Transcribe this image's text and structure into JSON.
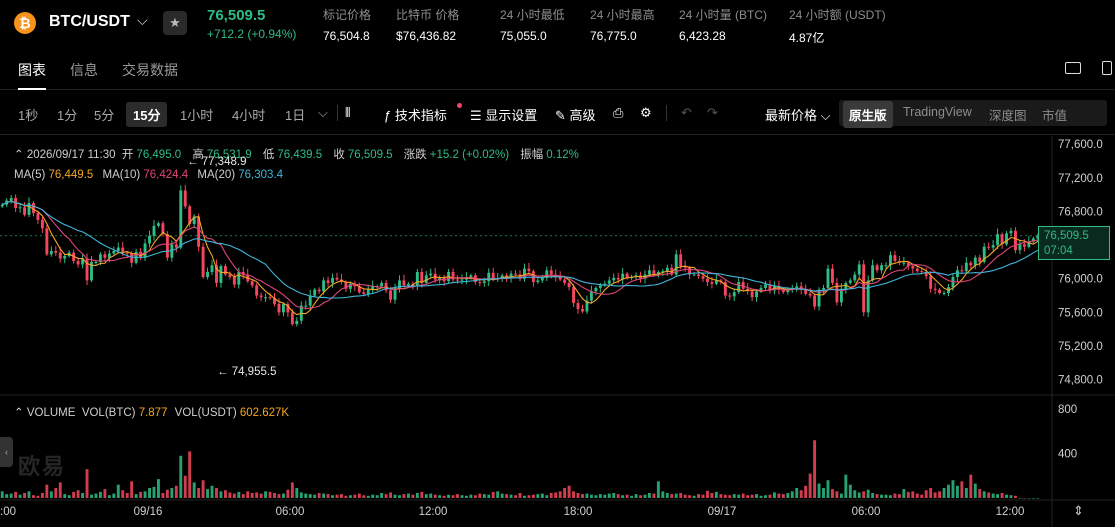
{
  "header": {
    "coin_symbol_glyph": "₿",
    "pair": "BTC/USDT",
    "last_price": "76,509.5",
    "change": "+712.2 (+0.94%)",
    "stats": [
      {
        "label": "标记价格",
        "value": "76,504.8"
      },
      {
        "label": "比特币 价格",
        "value": "$76,436.82"
      },
      {
        "label": "24 小时最低",
        "value": "75,055.0"
      },
      {
        "label": "24 小时最高",
        "value": "76,775.0"
      },
      {
        "label": "24 小时量 (BTC)",
        "value": "6,423.28"
      },
      {
        "label": "24 小时额 (USDT)",
        "value": "4.87亿"
      }
    ]
  },
  "tabs": [
    "图表",
    "信息",
    "交易数据"
  ],
  "toolbar": {
    "intervals": [
      "1秒",
      "1分",
      "5分",
      "15分",
      "1小时",
      "4小时",
      "1日"
    ],
    "selected_interval": "15分",
    "indicators_label": "技术指标",
    "display_label": "显示设置",
    "advanced_label": "高级",
    "price_type": "最新价格",
    "views": [
      "原生版",
      "TradingView",
      "深度图",
      "市值"
    ],
    "selected_view": "原生版"
  },
  "legend": {
    "datetime": "2026/09/17 11:30",
    "open_label": "开",
    "open": "76,495.0",
    "high_label": "高",
    "high": "76,531.9",
    "low_label": "低",
    "low": "76,439.5",
    "close_label": "收",
    "close": "76,509.5",
    "change_label": "涨跌",
    "change": "+15.2 (+0.02%)",
    "amp_label": "振幅",
    "amp": "0.12%",
    "ma5_label": "MA(5)",
    "ma5": "76,449.5",
    "ma10_label": "MA(10)",
    "ma10": "76,424.4",
    "ma20_label": "MA(20)",
    "ma20": "76,303.4",
    "volume_label": "VOLUME",
    "vol_btc_label": "VOL(BTC)",
    "vol_btc": "7.877",
    "vol_usdt_label": "VOL(USDT)",
    "vol_usdt": "602.627K"
  },
  "annotations": {
    "high_marker": "← 77,348.9",
    "low_marker": "← 74,955.5"
  },
  "price_tag": {
    "price": "76,509.5",
    "countdown": "07:04"
  },
  "watermark": "欧易",
  "colors": {
    "up": "#2ebd85",
    "down": "#f6465d",
    "ma5": "#f5a623",
    "ma10": "#e0457b",
    "ma20": "#3fb6d9",
    "accent": "#2ebd85"
  },
  "chart_data": {
    "type": "candlestick",
    "y_axis_ticks": [
      "77,600.0",
      "77,200.0",
      "76,800.0",
      "76,400.0",
      "76,000.0",
      "75,600.0",
      "75,200.0",
      "74,800.0"
    ],
    "y_range": [
      74700,
      77650
    ],
    "volume_ticks": [
      "800",
      "400"
    ],
    "volume_range": [
      0,
      900
    ],
    "x_axis_ticks": [
      ":00",
      "09/16",
      "06:00",
      "12:00",
      "18:00",
      "09/17",
      "06:00",
      "12:00"
    ],
    "close_path": [
      76880,
      76930,
      76960,
      76840,
      76850,
      76760,
      76900,
      76780,
      76700,
      76600,
      76290,
      76330,
      76310,
      76240,
      76270,
      76310,
      76210,
      76170,
      76240,
      75980,
      76200,
      76200,
      76290,
      76250,
      76300,
      76330,
      76370,
      76310,
      76300,
      76190,
      76320,
      76250,
      76420,
      76510,
      76630,
      76660,
      76530,
      76250,
      76410,
      76370,
      77050,
      76860,
      76650,
      76740,
      76380,
      76020,
      76080,
      76160,
      75950,
      76150,
      76050,
      76020,
      75930,
      76080,
      76050,
      75970,
      75920,
      75800,
      75780,
      75780,
      75770,
      75700,
      75600,
      75700,
      75600,
      75460,
      75500,
      75680,
      75680,
      75800,
      75870,
      75850,
      75980,
      75950,
      76010,
      75990,
      75960,
      75880,
      75940,
      75910,
      75840,
      75820,
      75870,
      75910,
      75910,
      75950,
      75860,
      75750,
      75890,
      75980,
      75920,
      75940,
      75910,
      76080,
      75950,
      76040,
      76060,
      75990,
      76020,
      75970,
      76080,
      75990,
      75980,
      75990,
      76010,
      76040,
      75960,
      75950,
      75970,
      76070,
      75990,
      76000,
      76040,
      76010,
      76060,
      76050,
      76000,
      76120,
      76090,
      75960,
      75980,
      76010,
      76100,
      76050,
      76020,
      75990,
      75950,
      75900,
      75710,
      75640,
      75610,
      75740,
      75850,
      75890,
      75920,
      75940,
      75980,
      76010,
      75990,
      76060,
      76010,
      76020,
      76040,
      76000,
      76050,
      76100,
      76050,
      76080,
      76090,
      76130,
      76050,
      76290,
      76150,
      76130,
      76050,
      76050,
      76030,
      76000,
      75960,
      75940,
      75980,
      75960,
      75800,
      75790,
      75840,
      75960,
      75880,
      75850,
      75780,
      75850,
      75890,
      75930,
      75860,
      75910,
      75870,
      75840,
      75870,
      75890,
      75910,
      75870,
      75820,
      75800,
      75670,
      75870,
      75890,
      76120,
      75950,
      75720,
      75880,
      75950,
      75980,
      76050,
      76170,
      75600,
      75980,
      76160,
      76100,
      76160,
      76160,
      76280,
      76210,
      76190,
      76190,
      76150,
      76120,
      76090,
      76080,
      76030,
      75880,
      75870,
      75830,
      75830,
      75900,
      76020,
      76100,
      76090,
      76190,
      76160,
      76250,
      76200,
      76380,
      76370,
      76400,
      76530,
      76410,
      76540,
      76570,
      76340,
      76410,
      76380,
      76440,
      76480,
      76510
    ],
    "volume_path": [
      60,
      35,
      40,
      55,
      30,
      45,
      60,
      25,
      20,
      45,
      120,
      60,
      90,
      140,
      35,
      25,
      55,
      70,
      45,
      260,
      30,
      40,
      55,
      80,
      25,
      40,
      120,
      70,
      45,
      150,
      35,
      55,
      60,
      90,
      100,
      170,
      45,
      75,
      90,
      110,
      380,
      200,
      420,
      140,
      90,
      160,
      80,
      110,
      90,
      60,
      70,
      50,
      40,
      55,
      35,
      60,
      45,
      50,
      40,
      60,
      55,
      45,
      35,
      40,
      75,
      140,
      90,
      50,
      40,
      35,
      30,
      45,
      40,
      35,
      25,
      30,
      35,
      20,
      25,
      30,
      40,
      25,
      20,
      30,
      25,
      45,
      35,
      50,
      30,
      25,
      35,
      40,
      30,
      45,
      55,
      35,
      40,
      30,
      25,
      20,
      30,
      25,
      35,
      25,
      20,
      30,
      25,
      40,
      35,
      30,
      55,
      60,
      40,
      35,
      30,
      25,
      45,
      20,
      25,
      30,
      35,
      40,
      25,
      45,
      50,
      60,
      90,
      110,
      60,
      45,
      35,
      40,
      30,
      25,
      35,
      30,
      40,
      45,
      35,
      25,
      30,
      20,
      35,
      25,
      30,
      45,
      40,
      150,
      60,
      45,
      35,
      40,
      45,
      30,
      25,
      20,
      35,
      30,
      65,
      45,
      55,
      35,
      30,
      25,
      35,
      30,
      40,
      25,
      30,
      35,
      20,
      25,
      30,
      50,
      40,
      35,
      45,
      60,
      90,
      70,
      110,
      220,
      520,
      130,
      90,
      160,
      80,
      60,
      40,
      210,
      120,
      70,
      50,
      60,
      75,
      45,
      35,
      30,
      30,
      25,
      40,
      35,
      80,
      55,
      60,
      40,
      30,
      70,
      90,
      50,
      60,
      90,
      120,
      160,
      110,
      150,
      90,
      210,
      130,
      80,
      60,
      50,
      40,
      35,
      45,
      30,
      25,
      20
    ]
  }
}
